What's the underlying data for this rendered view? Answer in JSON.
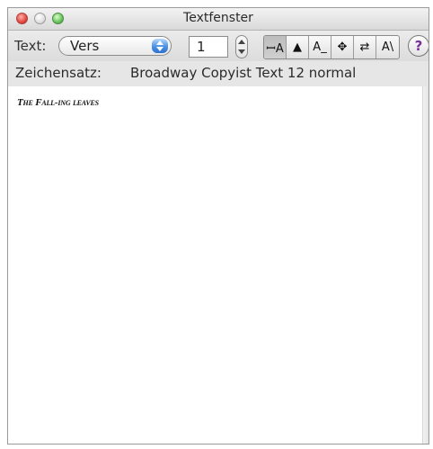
{
  "window": {
    "title": "Textfenster"
  },
  "toolbar": {
    "text_label": "Text:",
    "text_select_value": "Vers",
    "number_value": "1",
    "tools": [
      {
        "name": "text-cursor-tool-icon",
        "glyph": "ꟷA"
      },
      {
        "name": "arrow-pointer-icon",
        "glyph": "▲"
      },
      {
        "name": "text-baseline-icon",
        "glyph": "A_"
      },
      {
        "name": "move-icon",
        "glyph": "✥"
      },
      {
        "name": "swap-arrows-icon",
        "glyph": "⇄"
      },
      {
        "name": "text-style-icon",
        "glyph": "A\\"
      }
    ],
    "help_glyph": "?"
  },
  "font_info": {
    "label": "Zeichensatz:",
    "value": "Broadway Copyist Text 12 normal"
  },
  "editor": {
    "content": "The Fall-ing leaves"
  },
  "colors": {
    "close": "#e2463d",
    "zoom": "#66c25c",
    "select_accent": "#4b92e6",
    "help_accent": "#7a2e9c"
  }
}
